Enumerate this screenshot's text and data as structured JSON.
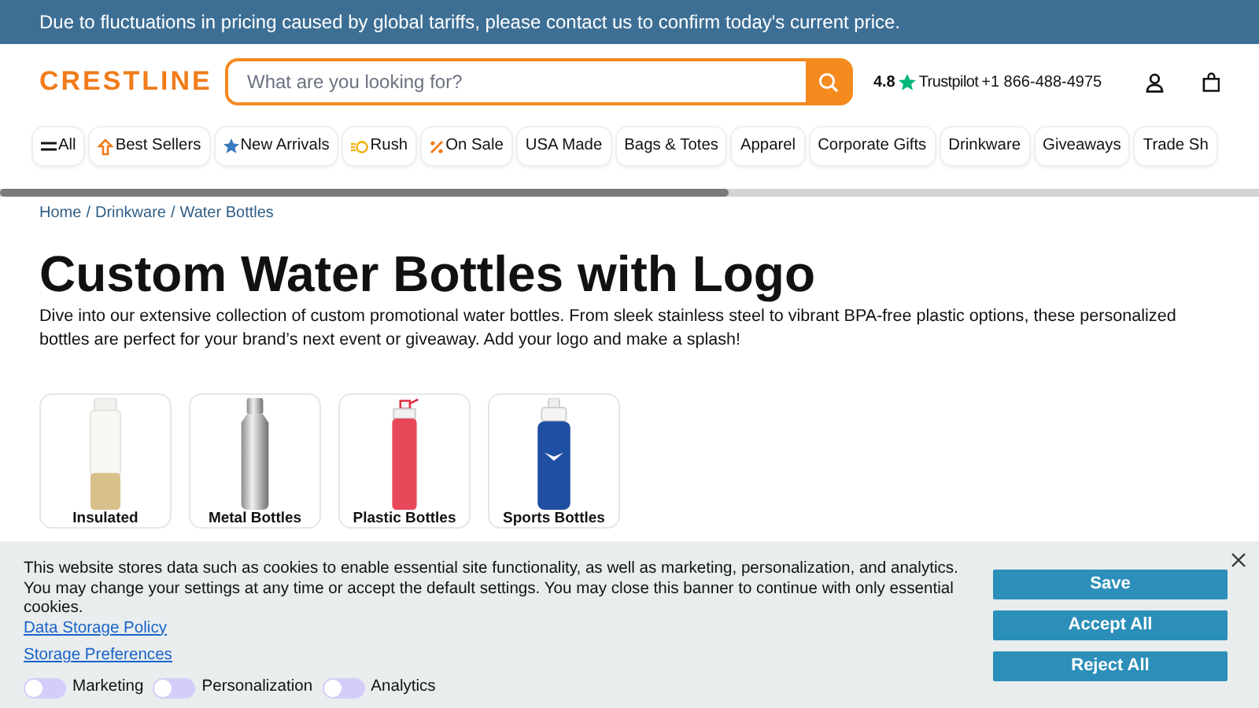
{
  "announcement": "Due to fluctuations in pricing caused by global tariffs, please contact us to confirm today's current price.",
  "header": {
    "logo": "CRESTLINE",
    "search": {
      "placeholder": "What are you looking for?"
    },
    "rating": "4.8",
    "trustpilot": "Trustpilot",
    "phone": "+1 866-488-4975"
  },
  "nav": [
    {
      "label": "All",
      "kind": "menu"
    },
    {
      "label": "Best Sellers",
      "kind": "up"
    },
    {
      "label": "New Arrivals",
      "kind": "star"
    },
    {
      "label": "Rush",
      "kind": "rush"
    },
    {
      "label": "On Sale",
      "kind": "percent"
    },
    {
      "label": "USA Made",
      "kind": "plain"
    },
    {
      "label": "Bags & Totes",
      "kind": "plain"
    },
    {
      "label": "Apparel",
      "kind": "plain"
    },
    {
      "label": "Corporate Gifts",
      "kind": "plain"
    },
    {
      "label": "Drinkware",
      "kind": "plain"
    },
    {
      "label": "Giveaways",
      "kind": "plain"
    },
    {
      "label": "Trade Sh",
      "kind": "plain"
    }
  ],
  "breadcrumb": {
    "separator": "/",
    "items": [
      "Home",
      "Drinkware",
      "Water Bottles"
    ]
  },
  "title": "Custom Water Bottles with Logo",
  "intro": "Dive into our extensive collection of custom promotional water bottles. From sleek stainless steel to vibrant BPA-free plastic options, these personalized bottles are perfect for your brand’s next event or giveaway. Add your logo and make a splash!",
  "categories": [
    {
      "label": "Insulated",
      "kind": "insulated"
    },
    {
      "label": "Metal Bottles",
      "kind": "metal"
    },
    {
      "label": "Plastic Bottles",
      "kind": "plastic"
    },
    {
      "label": "Sports Bottles",
      "kind": "sports"
    }
  ],
  "cookie_banner": {
    "text": "This website stores data such as cookies to enable essential site functionality, as well as marketing, personalization, and analytics. You may change your settings at any time or accept the default settings. You may close this banner to continue with only essential cookies.",
    "policy_link": "Data Storage Policy",
    "preferences_link": "Storage Preferences",
    "toggles": [
      {
        "label": "Marketing",
        "on": false
      },
      {
        "label": "Personalization",
        "on": false
      },
      {
        "label": "Analytics",
        "on": false
      }
    ],
    "buttons": [
      "Save",
      "Accept All",
      "Reject All"
    ]
  }
}
